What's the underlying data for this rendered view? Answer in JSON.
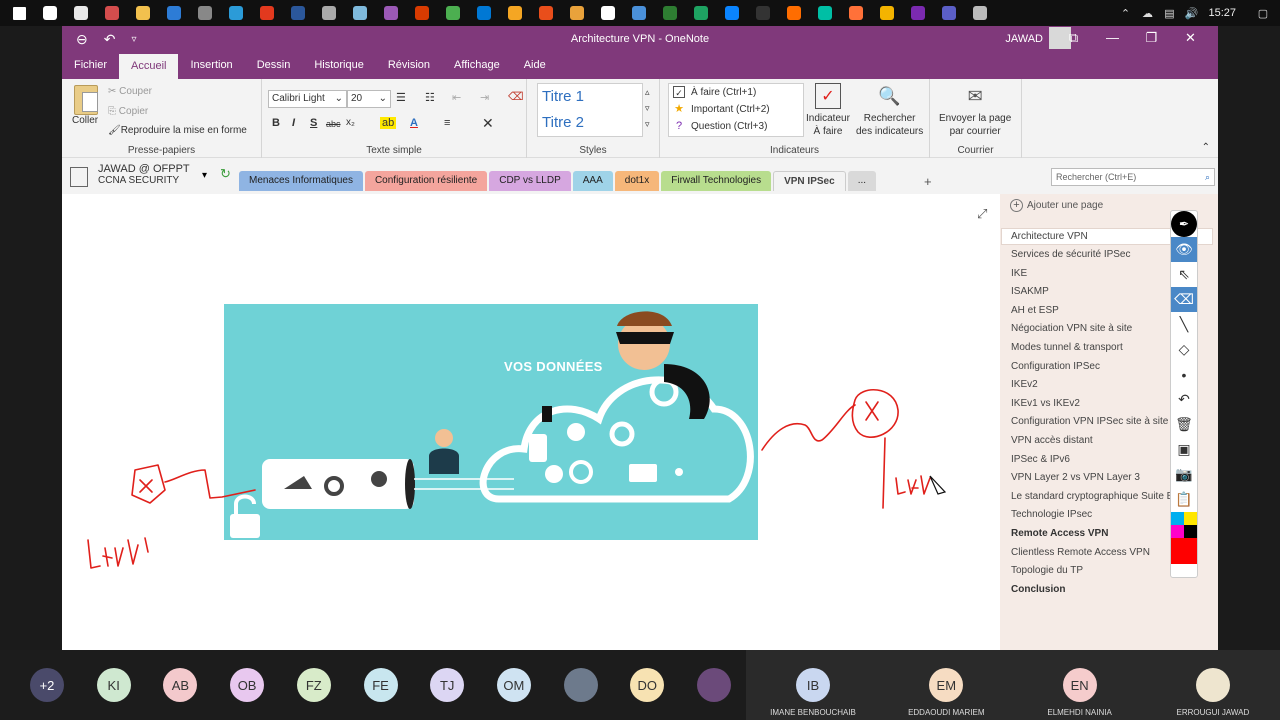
{
  "taskbar": {
    "time": "15:27",
    "app_icon_colors": [
      "#ffffff",
      "#e8e8e8",
      "#d44d4d",
      "#f2c14e",
      "#2d7cd6",
      "#888888",
      "#2b9bd8",
      "#e2391e",
      "#2b579a",
      "#aaaaaa",
      "#7fbadc",
      "#9b59b6",
      "#d83b01",
      "#4caf50",
      "#0078d4",
      "#f5a623",
      "#e94e1b",
      "#e9a23b",
      "#ffffff",
      "#4a90d9",
      "#2e7d32",
      "#1ea362",
      "#0a84ff",
      "#333333",
      "#ff6d00",
      "#00bfa5",
      "#ff7139",
      "#f4b400",
      "#7b2ab0",
      "#5b5fc7",
      "#bbbbbb"
    ]
  },
  "window": {
    "title": "Architecture VPN  -  OneNote",
    "user": "JAWAD"
  },
  "ribbon": {
    "tabs": [
      {
        "label": "Fichier",
        "active": false
      },
      {
        "label": "Accueil",
        "active": true
      },
      {
        "label": "Insertion",
        "active": false
      },
      {
        "label": "Dessin",
        "active": false
      },
      {
        "label": "Historique",
        "active": false
      },
      {
        "label": "Révision",
        "active": false
      },
      {
        "label": "Affichage",
        "active": false
      },
      {
        "label": "Aide",
        "active": false
      }
    ],
    "clipboard": {
      "paste": "Coller",
      "cut": "Couper",
      "copy": "Copier",
      "format_painter": "Reproduire la mise en forme",
      "label": "Presse-papiers"
    },
    "font": {
      "family": "Calibri Light",
      "size": "20",
      "label": "Texte simple"
    },
    "styles": {
      "title1": "Titre 1",
      "title2": "Titre 2",
      "label": "Styles"
    },
    "tags": {
      "todo": "À faire (Ctrl+1)",
      "important": "Important (Ctrl+2)",
      "question": "Question (Ctrl+3)",
      "todo_tag_line1": "Indicateur",
      "todo_tag_line2": "À faire",
      "find_tags_line1": "Rechercher",
      "find_tags_line2": "des indicateurs",
      "label": "Indicateurs"
    },
    "email": {
      "line1": "Envoyer la page",
      "line2": "par courrier",
      "label": "Courrier"
    }
  },
  "notebook": {
    "name": "JAWAD @ OFPPT",
    "section_group": "CCNA SECURITY",
    "sections": [
      {
        "label": "Menaces Informatiques",
        "color": "#8fb4e3"
      },
      {
        "label": "Configuration résiliente",
        "color": "#f4a59d"
      },
      {
        "label": "CDP vs LLDP",
        "color": "#d6a7e0"
      },
      {
        "label": "AAA",
        "color": "#9fd3e8"
      },
      {
        "label": "dot1x",
        "color": "#f6b77a"
      },
      {
        "label": "Firwall Technologies",
        "color": "#b8dd8e"
      },
      {
        "label": "VPN IPSec",
        "color": "#f3f3f3"
      },
      {
        "label": "...",
        "color": "#d9d9d9"
      }
    ],
    "search_placeholder": "Rechercher (Ctrl+E)"
  },
  "canvas": {
    "image_caption": "VOS DONNÉES",
    "colors": {
      "ink": "#e0201b",
      "hero_bg": "#6fd2d6"
    }
  },
  "pages": {
    "add_label": "Ajouter une page",
    "current": "Architecture VPN",
    "items": [
      {
        "label": "Services de sécurité IPSec",
        "bold": false
      },
      {
        "label": "IKE",
        "bold": false
      },
      {
        "label": "ISAKMP",
        "bold": false
      },
      {
        "label": "AH et ESP",
        "bold": false
      },
      {
        "label": "Négociation VPN site à site",
        "bold": false
      },
      {
        "label": "Modes tunnel & transport",
        "bold": false
      },
      {
        "label": "Configuration IPSec",
        "bold": false
      },
      {
        "label": "IKEv2",
        "bold": false
      },
      {
        "label": "IKEv1 vs IKEv2",
        "bold": false
      },
      {
        "label": "Configuration VPN IPSec site à site",
        "bold": false
      },
      {
        "label": "VPN accès distant",
        "bold": false
      },
      {
        "label": "IPSec & IPv6",
        "bold": false
      },
      {
        "label": "VPN Layer 2 vs VPN Layer 3",
        "bold": false
      },
      {
        "label": "Le standard cryptographique Suite B",
        "bold": false
      },
      {
        "label": "Technologie IPsec",
        "bold": false
      },
      {
        "label": "Remote Access VPN",
        "bold": true
      },
      {
        "label": "Clientless Remote Access VPN",
        "bold": false
      },
      {
        "label": "Topologie du TP",
        "bold": false
      },
      {
        "label": "Conclusion",
        "bold": true
      }
    ]
  },
  "meeting": {
    "participants": [
      {
        "initials": "+2",
        "color": "#4a4a6a"
      },
      {
        "initials": "KI",
        "color": "#cfe8d0"
      },
      {
        "initials": "AB",
        "color": "#f3c9cc"
      },
      {
        "initials": "OB",
        "color": "#e8c8ef"
      },
      {
        "initials": "FZ",
        "color": "#d8ebc9"
      },
      {
        "initials": "FE",
        "color": "#c8e6ef"
      },
      {
        "initials": "TJ",
        "color": "#dcd6f3"
      },
      {
        "initials": "OM",
        "color": "#cfe3f2"
      },
      {
        "initials": "",
        "color": "#6d7a8c"
      },
      {
        "initials": "DO",
        "color": "#f7e2b2"
      },
      {
        "initials": "",
        "color": "#6b4a7a"
      }
    ],
    "video_tiles": [
      {
        "initials": "IB",
        "name": "IMANE BENBOUCHAIB",
        "color": "#c9d7f0"
      },
      {
        "initials": "EM",
        "name": "EDDAOUDI MARIEM",
        "color": "#f6dcc2"
      },
      {
        "initials": "EN",
        "name": "ELMEHDI NAINIA",
        "color": "#f5cccc"
      },
      {
        "initials": "",
        "name": "ERROUGUI JAWAD",
        "color": "#eee5cf"
      }
    ]
  }
}
